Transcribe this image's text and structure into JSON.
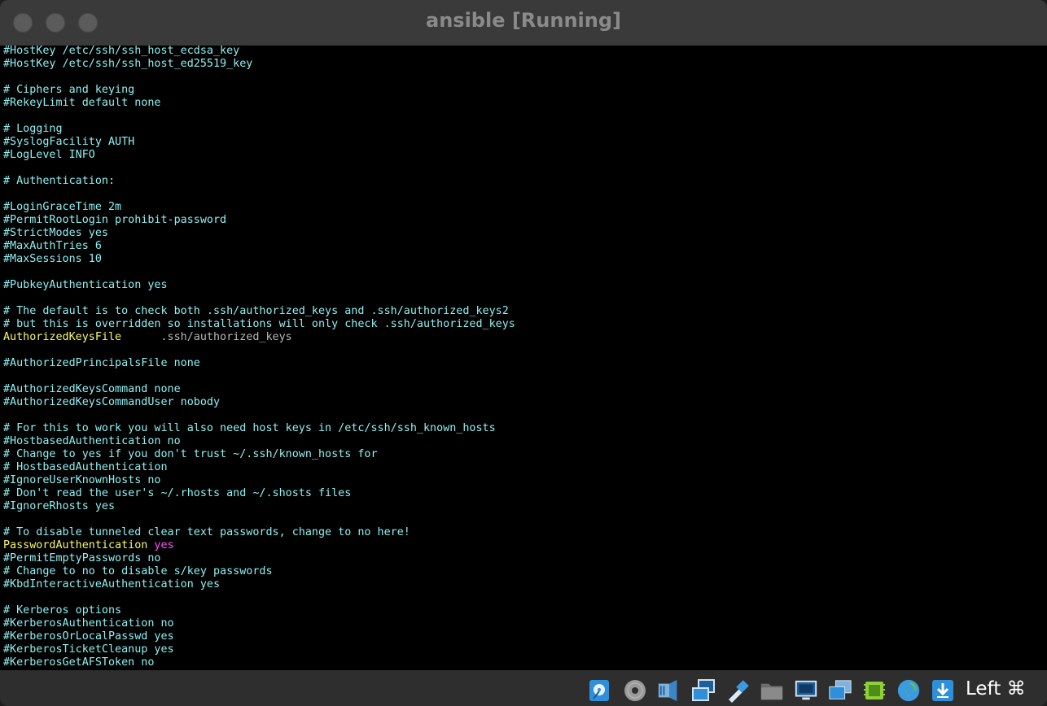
{
  "window": {
    "title": "ansible [Running]"
  },
  "terminal": {
    "lines": [
      {
        "segments": [
          {
            "text": "#HostKey /etc/ssh/ssh_host_ecdsa_key",
            "style": "cyan"
          }
        ]
      },
      {
        "segments": [
          {
            "text": "#HostKey /etc/ssh/ssh_host_ed25519_key",
            "style": "cyan"
          }
        ]
      },
      {
        "segments": [
          {
            "text": "",
            "style": "cyan"
          }
        ]
      },
      {
        "segments": [
          {
            "text": "# Ciphers and keying",
            "style": "cyan"
          }
        ]
      },
      {
        "segments": [
          {
            "text": "#RekeyLimit default none",
            "style": "cyan"
          }
        ]
      },
      {
        "segments": [
          {
            "text": "",
            "style": "cyan"
          }
        ]
      },
      {
        "segments": [
          {
            "text": "# Logging",
            "style": "cyan"
          }
        ]
      },
      {
        "segments": [
          {
            "text": "#SyslogFacility AUTH",
            "style": "cyan"
          }
        ]
      },
      {
        "segments": [
          {
            "text": "#LogLevel INFO",
            "style": "cyan"
          }
        ]
      },
      {
        "segments": [
          {
            "text": "",
            "style": "cyan"
          }
        ]
      },
      {
        "segments": [
          {
            "text": "# Authentication:",
            "style": "cyan"
          }
        ]
      },
      {
        "segments": [
          {
            "text": "",
            "style": "cyan"
          }
        ]
      },
      {
        "segments": [
          {
            "text": "#LoginGraceTime 2m",
            "style": "cyan"
          }
        ]
      },
      {
        "segments": [
          {
            "text": "#PermitRootLogin prohibit-password",
            "style": "cyan"
          }
        ]
      },
      {
        "segments": [
          {
            "text": "#StrictModes yes",
            "style": "cyan"
          }
        ]
      },
      {
        "segments": [
          {
            "text": "#MaxAuthTries 6",
            "style": "cyan"
          }
        ]
      },
      {
        "segments": [
          {
            "text": "#MaxSessions 10",
            "style": "cyan"
          }
        ]
      },
      {
        "segments": [
          {
            "text": "",
            "style": "cyan"
          }
        ]
      },
      {
        "segments": [
          {
            "text": "#PubkeyAuthentication yes",
            "style": "cyan"
          }
        ]
      },
      {
        "segments": [
          {
            "text": "",
            "style": "cyan"
          }
        ]
      },
      {
        "segments": [
          {
            "text": "# The default is to check both .ssh/authorized_keys and .ssh/authorized_keys2",
            "style": "cyan"
          }
        ]
      },
      {
        "segments": [
          {
            "text": "# but this is overridden so installations will only check .ssh/authorized_keys",
            "style": "cyan"
          }
        ]
      },
      {
        "segments": [
          {
            "text": "AuthorizedKeysFile",
            "style": "yellow"
          },
          {
            "text": "      .ssh/authorized_keys",
            "style": "gray"
          }
        ]
      },
      {
        "segments": [
          {
            "text": "",
            "style": "cyan"
          }
        ]
      },
      {
        "segments": [
          {
            "text": "#AuthorizedPrincipalsFile none",
            "style": "cyan"
          }
        ]
      },
      {
        "segments": [
          {
            "text": "",
            "style": "cyan"
          }
        ]
      },
      {
        "segments": [
          {
            "text": "#AuthorizedKeysCommand none",
            "style": "cyan"
          }
        ]
      },
      {
        "segments": [
          {
            "text": "#AuthorizedKeysCommandUser nobody",
            "style": "cyan"
          }
        ]
      },
      {
        "segments": [
          {
            "text": "",
            "style": "cyan"
          }
        ]
      },
      {
        "segments": [
          {
            "text": "# For this to work you will also need host keys in /etc/ssh/ssh_known_hosts",
            "style": "cyan"
          }
        ]
      },
      {
        "segments": [
          {
            "text": "#HostbasedAuthentication no",
            "style": "cyan"
          }
        ]
      },
      {
        "segments": [
          {
            "text": "# Change to yes if you don't trust ~/.ssh/known_hosts for",
            "style": "cyan"
          }
        ]
      },
      {
        "segments": [
          {
            "text": "# HostbasedAuthentication",
            "style": "cyan"
          }
        ]
      },
      {
        "segments": [
          {
            "text": "#IgnoreUserKnownHosts no",
            "style": "cyan"
          }
        ]
      },
      {
        "segments": [
          {
            "text": "# Don't read the user's ~/.rhosts and ~/.shosts files",
            "style": "cyan"
          }
        ]
      },
      {
        "segments": [
          {
            "text": "#IgnoreRhosts yes",
            "style": "cyan"
          }
        ]
      },
      {
        "segments": [
          {
            "text": "",
            "style": "cyan"
          }
        ]
      },
      {
        "segments": [
          {
            "text": "# To disable tunneled clear text passwords, change to no here!",
            "style": "cyan"
          }
        ]
      },
      {
        "segments": [
          {
            "text": "PasswordAuthentication",
            "style": "yellow"
          },
          {
            "text": " yes",
            "style": "magenta"
          }
        ]
      },
      {
        "segments": [
          {
            "text": "#PermitEmptyPasswords no",
            "style": "cyan"
          }
        ]
      },
      {
        "segments": [
          {
            "text": "# Change to no to disable s/key passwords",
            "style": "cyan"
          }
        ]
      },
      {
        "segments": [
          {
            "text": "#KbdInteractiveAuthentication yes",
            "style": "cyan"
          }
        ]
      },
      {
        "segments": [
          {
            "text": "",
            "style": "cyan"
          }
        ]
      },
      {
        "segments": [
          {
            "text": "# Kerberos options",
            "style": "cyan"
          }
        ]
      },
      {
        "segments": [
          {
            "text": "#KerberosAuthentication no",
            "style": "cyan"
          }
        ]
      },
      {
        "segments": [
          {
            "text": "#KerberosOrLocalPasswd yes",
            "style": "cyan"
          }
        ]
      },
      {
        "segments": [
          {
            "text": "#KerberosTicketCleanup yes",
            "style": "cyan"
          }
        ]
      },
      {
        "segments": [
          {
            "text": "#KerberosGetAFSToken no",
            "style": "cyan"
          }
        ]
      }
    ]
  },
  "statusbar": {
    "icons": [
      "hard-disk-icon",
      "optical-drive-icon",
      "audio-icon",
      "network-icon",
      "usb-icon",
      "shared-folder-icon",
      "display-icon",
      "video-capture-icon",
      "cpu-activity-icon",
      "globe-icon",
      "download-icon"
    ],
    "host_key_label": "Left ⌘"
  },
  "colors": {
    "cyan": "#8ff0f2",
    "yellow": "#f7f76a",
    "gray": "#b8b8b8",
    "magenta": "#ff55ff"
  }
}
